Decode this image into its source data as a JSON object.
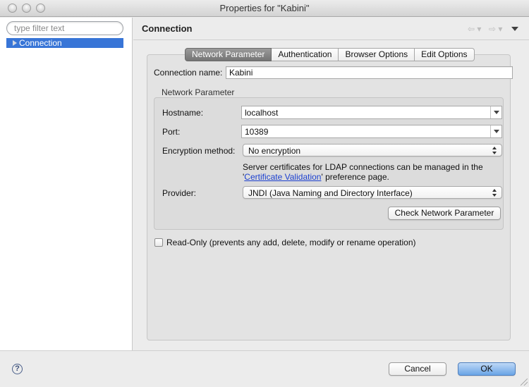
{
  "window": {
    "title": "Properties for \"Kabini\""
  },
  "sidebar": {
    "filter_placeholder": "type filter text",
    "items": [
      {
        "label": "Connection",
        "selected": true
      }
    ]
  },
  "page": {
    "title": "Connection",
    "back_icon": "arrow-left-icon",
    "forward_icon": "arrow-right-icon",
    "menu_icon": "view-menu-icon"
  },
  "tabs": [
    {
      "label": "Network Parameter",
      "active": true
    },
    {
      "label": "Authentication",
      "active": false
    },
    {
      "label": "Browser Options",
      "active": false
    },
    {
      "label": "Edit Options",
      "active": false
    }
  ],
  "form": {
    "connection_name_label": "Connection name:",
    "connection_name_value": "Kabini",
    "group_title": "Network Parameter",
    "hostname_label": "Hostname:",
    "hostname_value": "localhost",
    "port_label": "Port:",
    "port_value": "10389",
    "encryption_label": "Encryption method:",
    "encryption_value": "No encryption",
    "info_prefix": "Server certificates for LDAP connections can be managed in the '",
    "info_link": "Certificate Validation",
    "info_suffix": "' preference page.",
    "provider_label": "Provider:",
    "provider_value": "JNDI (Java Naming and Directory Interface)",
    "check_button": "Check Network Parameter",
    "readonly_label": "Read-Only (prevents any add, delete, modify or rename operation)",
    "readonly_checked": false
  },
  "buttons": {
    "cancel": "Cancel",
    "ok": "OK",
    "help_glyph": "?"
  },
  "colors": {
    "selection": "#3875d7",
    "link": "#1a3fcf",
    "active_tab": "#808080"
  }
}
